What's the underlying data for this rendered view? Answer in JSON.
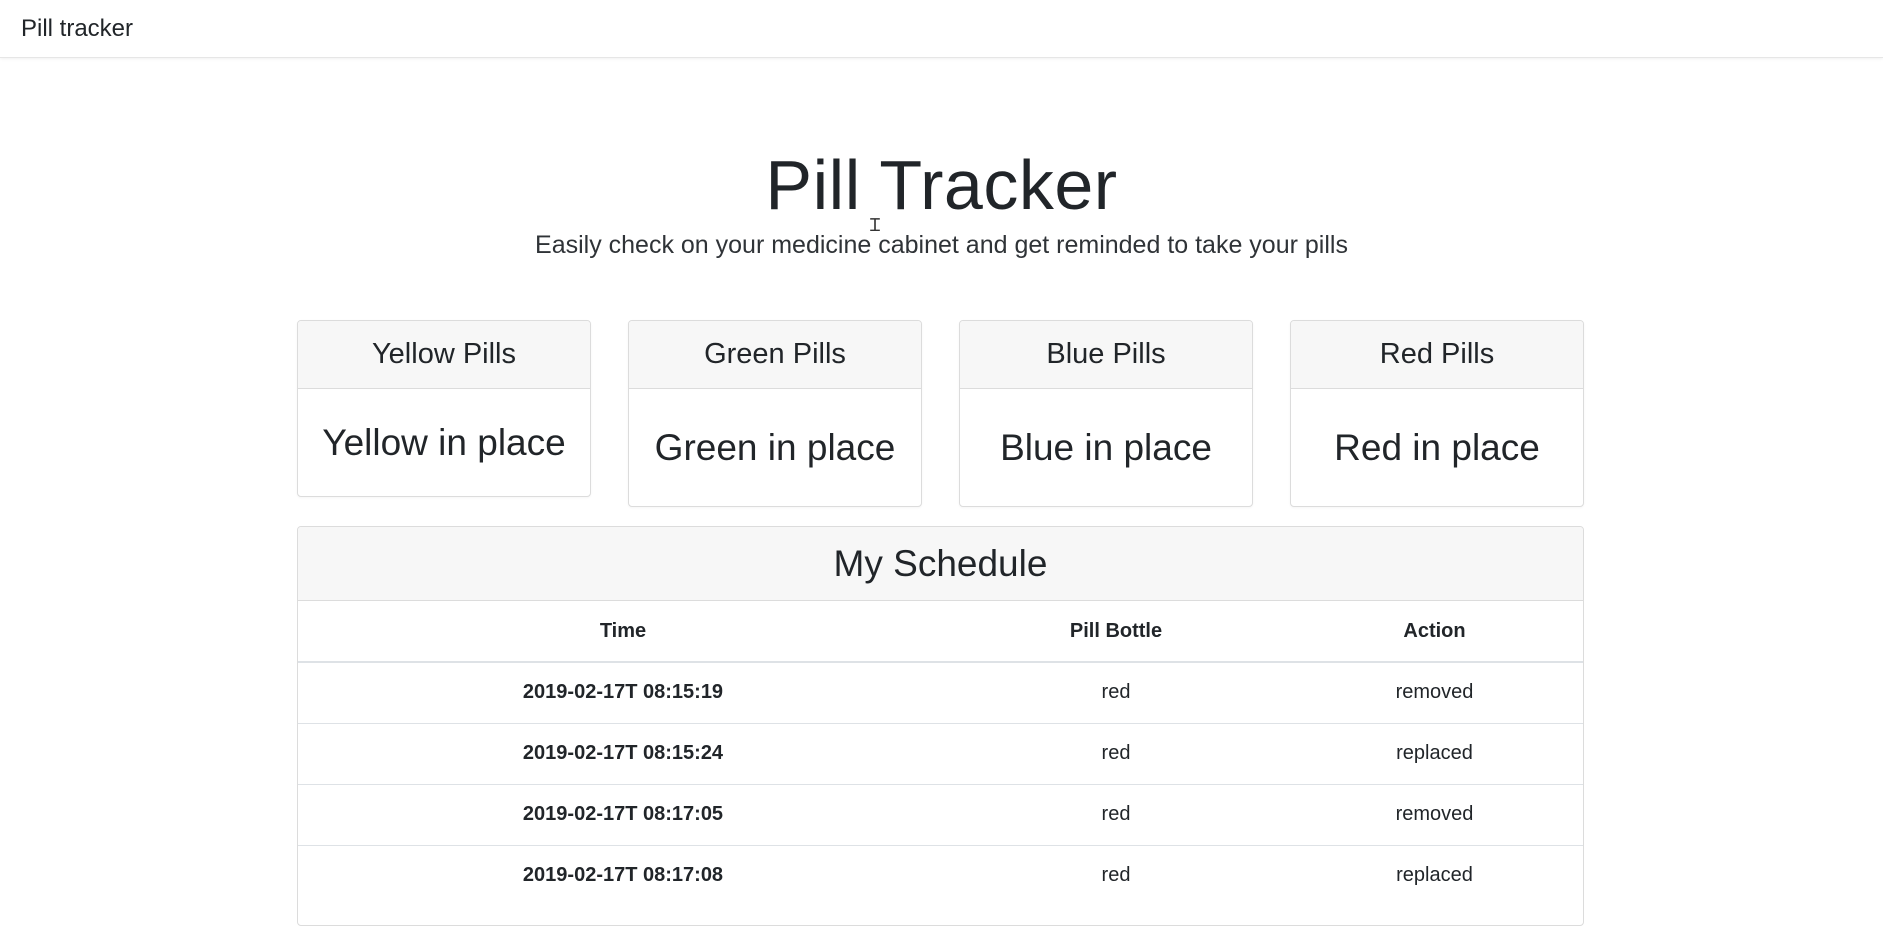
{
  "navbar": {
    "brand": "Pill tracker"
  },
  "hero": {
    "title": "Pill Tracker",
    "subtitle": "Easily check on your medicine cabinet and get reminded to take your pills"
  },
  "cards": [
    {
      "title": "Yellow Pills",
      "status": "Yellow in place"
    },
    {
      "title": "Green Pills",
      "status": "Green in place"
    },
    {
      "title": "Blue Pills",
      "status": "Blue in place"
    },
    {
      "title": "Red Pills",
      "status": "Red in place"
    }
  ],
  "schedule": {
    "title": "My Schedule",
    "columns": [
      "Time",
      "Pill Bottle",
      "Action"
    ],
    "rows": [
      [
        "2019-02-17T 08:15:19",
        "red",
        "removed"
      ],
      [
        "2019-02-17T 08:15:24",
        "red",
        "replaced"
      ],
      [
        "2019-02-17T 08:17:05",
        "red",
        "removed"
      ],
      [
        "2019-02-17T 08:17:08",
        "red",
        "replaced"
      ]
    ]
  }
}
